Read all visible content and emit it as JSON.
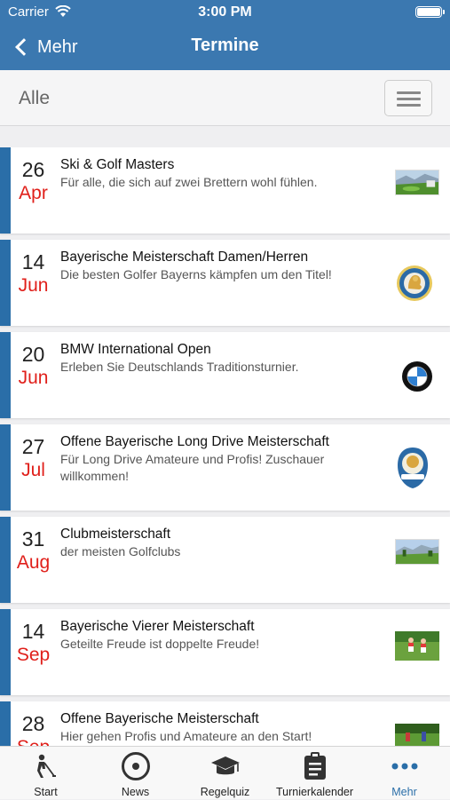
{
  "status": {
    "carrier": "Carrier",
    "time": "3:00 PM"
  },
  "nav": {
    "back_label": "Mehr",
    "title": "Termine"
  },
  "filter": {
    "label": "Alle"
  },
  "events": [
    {
      "day": "26",
      "month": "Apr",
      "title": "Ski & Golf Masters",
      "description": "Für alle, die sich auf zwei Brettern wohl fühlen.",
      "image": "golf-course-photo"
    },
    {
      "day": "14",
      "month": "Jun",
      "title": "Bayerische Meisterschaft Damen/Herren",
      "description": "Die besten Golfer Bayerns kämpfen um den Titel!",
      "image": "bgv-lion-logo"
    },
    {
      "day": "20",
      "month": "Jun",
      "title": "BMW International Open",
      "description": "Erleben Sie Deutschlands Traditionsturnier.",
      "image": "bmw-logo"
    },
    {
      "day": "27",
      "month": "Jul",
      "title": "Offene Bayerische Long Drive Meisterschaft",
      "description": "Für Long Drive Amateure und Profis! Zuschauer willkommen!",
      "image": "long-drive-logo"
    },
    {
      "day": "31",
      "month": "Aug",
      "title": "Clubmeisterschaft",
      "description": "der meisten Golfclubs",
      "image": "golf-landscape-photo"
    },
    {
      "day": "14",
      "month": "Sep",
      "title": "Bayerische Vierer Meisterschaft",
      "description": "Geteilte Freude ist doppelte Freude!",
      "image": "golfer-pair-photo"
    },
    {
      "day": "28",
      "month": "Sep",
      "title": "Offene Bayerische Meisterschaft",
      "description": "Hier gehen Profis und Amateure an den Start!",
      "image": "golf-players-photo"
    }
  ],
  "tabs": [
    {
      "label": "Start",
      "icon": "golfer-icon"
    },
    {
      "label": "News",
      "icon": "target-icon"
    },
    {
      "label": "Regelquiz",
      "icon": "graduation-cap-icon"
    },
    {
      "label": "Turnierkalender",
      "icon": "clipboard-icon"
    },
    {
      "label": "Mehr",
      "icon": "more-dots-icon",
      "active": true
    }
  ],
  "colors": {
    "brand": "#3b78b0",
    "accent": "#2a6ea8",
    "month": "#e0201b"
  }
}
